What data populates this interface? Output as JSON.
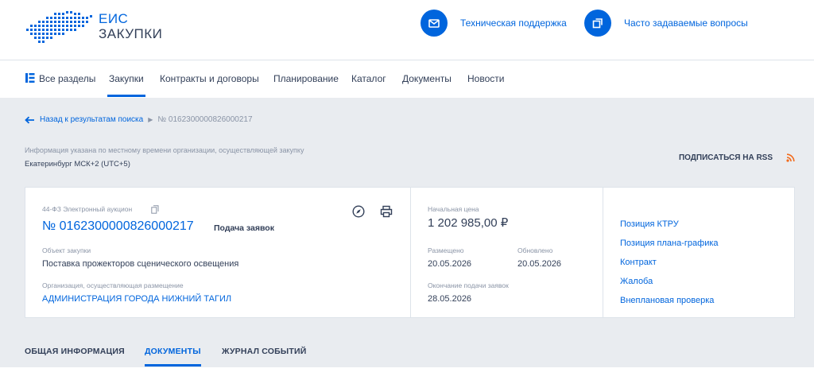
{
  "brand": {
    "line1": "ЕИС",
    "line2": "ЗАКУПКИ"
  },
  "header_links": [
    {
      "label": "Техническая поддержка",
      "icon": "mail-icon"
    },
    {
      "label": "Часто задаваемые вопросы",
      "icon": "copy-windows-icon"
    }
  ],
  "nav": {
    "items": [
      "Все разделы",
      "Закупки",
      "Контракты и договоры",
      "Планирование",
      "Каталог",
      "Документы",
      "Новости"
    ],
    "active": "Закупки"
  },
  "breadcrumb": {
    "back": "Назад к результатам поиска",
    "current": "№ 0162300000826000217"
  },
  "timezone": {
    "note": "Информация указана по местному времени организации, осуществляющей закупку",
    "value": "Екатеринбург МСК+2 (UTC+5)"
  },
  "rss_label": "ПОДПИСАТЬСЯ НА RSS",
  "purchase": {
    "type": "44-ФЗ Электронный аукцион",
    "number": "№ 0162300000826000217",
    "status": "Подача заявок",
    "object_label": "Объект закупки",
    "object_value": "Поставка прожекторов сценического освещения",
    "org_label": "Организация, осуществляющая размещение",
    "org_value": "АДМИНИСТРАЦИЯ ГОРОДА НИЖНИЙ ТАГИЛ"
  },
  "price": {
    "label": "Начальная цена",
    "value": "1 202 985,00 ₽",
    "placed_label": "Размещено",
    "placed_value": "20.05.2026",
    "updated_label": "Обновлено",
    "updated_value": "20.05.2026",
    "end_label": "Окончание подачи заявок",
    "end_value": "28.05.2026"
  },
  "side_links": [
    "Позиция КТРУ",
    "Позиция плана-графика",
    "Контракт",
    "Жалоба",
    "Внеплановая проверка"
  ],
  "tabs": [
    "ОБЩАЯ ИНФОРМАЦИЯ",
    "ДОКУМЕНТЫ",
    "ЖУРНАЛ СОБЫТИЙ"
  ],
  "active_tab": "ДОКУМЕНТЫ",
  "colors": {
    "accent": "#0065dd",
    "text": "#334059",
    "muted": "#8a94a6",
    "background": "#e9ecf0",
    "rss": "#f26a1b"
  }
}
